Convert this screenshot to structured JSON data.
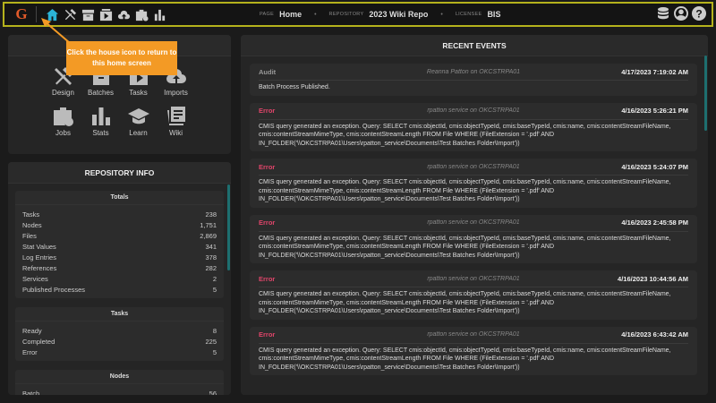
{
  "topbar": {
    "logo": "G",
    "page_label": "PAGE",
    "page": "Home",
    "repo_label": "REPOSITORY",
    "repo": "2023 Wiki Repo",
    "lic_label": "LICENSEE",
    "licensee": "BIS"
  },
  "tooltip": "Click the house icon to return to this home screen",
  "quick": [
    {
      "label": "Design",
      "icon": "tools-icon"
    },
    {
      "label": "Batches",
      "icon": "archive-icon"
    },
    {
      "label": "Tasks",
      "icon": "play-icon"
    },
    {
      "label": "Imports",
      "icon": "cloud-upload-icon"
    },
    {
      "label": "Jobs",
      "icon": "briefcase-clock-icon"
    },
    {
      "label": "Stats",
      "icon": "bar-chart-icon"
    },
    {
      "label": "Learn",
      "icon": "graduation-cap-icon"
    },
    {
      "label": "Wiki",
      "icon": "document-icon"
    }
  ],
  "repo_info": {
    "title": "REPOSITORY INFO",
    "sections": [
      {
        "title": "Totals",
        "rows": [
          [
            "Tasks",
            "238"
          ],
          [
            "Nodes",
            "1,751"
          ],
          [
            "Files",
            "2,869"
          ],
          [
            "Stat Values",
            "341"
          ],
          [
            "Log Entries",
            "378"
          ],
          [
            "References",
            "282"
          ],
          [
            "Services",
            "2"
          ],
          [
            "Published Processes",
            "5"
          ]
        ]
      },
      {
        "title": "Tasks",
        "rows": [
          [
            "Ready",
            "8"
          ],
          [
            "Completed",
            "225"
          ],
          [
            "Error",
            "5"
          ]
        ]
      },
      {
        "title": "Nodes",
        "rows": [
          [
            "Batch",
            "56"
          ]
        ]
      }
    ]
  },
  "events": {
    "title": "RECENT EVENTS",
    "items": [
      {
        "type": "Audit",
        "user": "Reanna Patton on OKCSTRPA01",
        "date": "4/17/2023 7:19:02 AM",
        "body": "Batch Process Published."
      },
      {
        "type": "Error",
        "user": "rpatton service on OKCSTRPA01",
        "date": "4/16/2023 5:26:21 PM",
        "body": "CMIS query generated an exception. Query: SELECT cmis:objectId, cmis:objectTypeId, cmis:baseTypeId, cmis:name, cmis:contentStreamFileName, cmis:contentStreamMimeType, cmis:contentStreamLength FROM File WHERE (FileExtension = '.pdf' AND IN_FOLDER('\\\\OKCSTRPA01\\Users\\rpatton_service\\Documents\\Test Batches Folder\\Import'))"
      },
      {
        "type": "Error",
        "user": "rpatton service on OKCSTRPA01",
        "date": "4/16/2023 5:24:07 PM",
        "body": "CMIS query generated an exception. Query: SELECT cmis:objectId, cmis:objectTypeId, cmis:baseTypeId, cmis:name, cmis:contentStreamFileName, cmis:contentStreamMimeType, cmis:contentStreamLength FROM File WHERE (FileExtension = '.pdf' AND IN_FOLDER('\\\\OKCSTRPA01\\Users\\rpatton_service\\Documents\\Test Batches Folder\\Import'))"
      },
      {
        "type": "Error",
        "user": "rpatton service on OKCSTRPA01",
        "date": "4/16/2023 2:45:58 PM",
        "body": "CMIS query generated an exception. Query: SELECT cmis:objectId, cmis:objectTypeId, cmis:baseTypeId, cmis:name, cmis:contentStreamFileName, cmis:contentStreamMimeType, cmis:contentStreamLength FROM File WHERE (FileExtension = '.pdf' AND IN_FOLDER('\\\\OKCSTRPA01\\Users\\rpatton_service\\Documents\\Test Batches Folder\\Import'))"
      },
      {
        "type": "Error",
        "user": "rpatton service on OKCSTRPA01",
        "date": "4/16/2023 10:44:56 AM",
        "body": "CMIS query generated an exception. Query: SELECT cmis:objectId, cmis:objectTypeId, cmis:baseTypeId, cmis:name, cmis:contentStreamFileName, cmis:contentStreamMimeType, cmis:contentStreamLength FROM File WHERE (FileExtension = '.pdf' AND IN_FOLDER('\\\\OKCSTRPA01\\Users\\rpatton_service\\Documents\\Test Batches Folder\\Import'))"
      },
      {
        "type": "Error",
        "user": "rpatton service on OKCSTRPA01",
        "date": "4/16/2023 6:43:42 AM",
        "body": "CMIS query generated an exception. Query: SELECT cmis:objectId, cmis:objectTypeId, cmis:baseTypeId, cmis:name, cmis:contentStreamFileName, cmis:contentStreamMimeType, cmis:contentStreamLength FROM File WHERE (FileExtension = '.pdf' AND IN_FOLDER('\\\\OKCSTRPA01\\Users\\rpatton_service\\Documents\\Test Batches Folder\\Import'))"
      }
    ]
  },
  "colors": {
    "accent": "#2bb3d6",
    "error": "#e0456a",
    "tooltip": "#f39a25",
    "frame": "#b5b21c"
  }
}
